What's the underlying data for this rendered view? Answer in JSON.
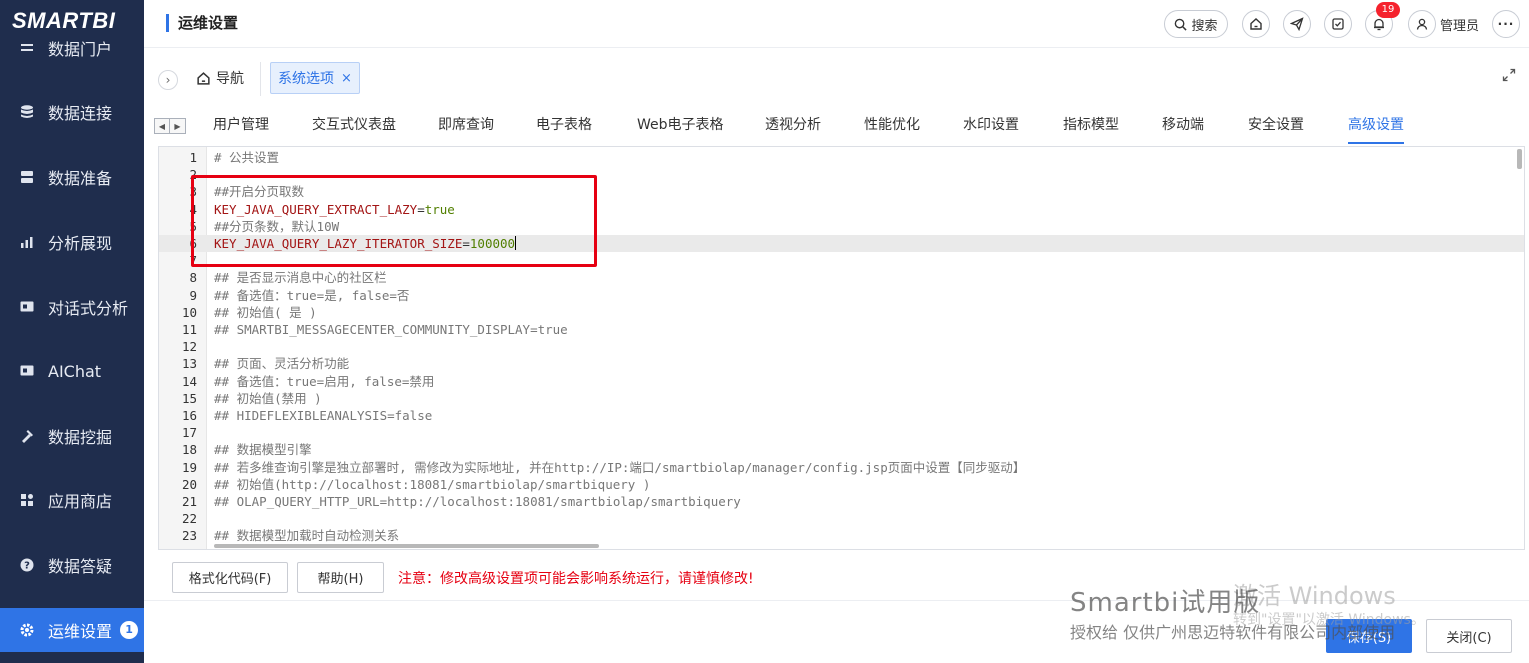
{
  "logo": "SMARTBI",
  "sidebar": {
    "items": [
      {
        "label": "数据门户",
        "icon": "portal-icon"
      },
      {
        "label": "数据连接",
        "icon": "database-icon"
      },
      {
        "label": "数据准备",
        "icon": "data-prep-icon"
      },
      {
        "label": "分析展现",
        "icon": "bar-chart-icon"
      },
      {
        "label": "对话式分析",
        "icon": "dialog-analysis-icon"
      },
      {
        "label": "AIChat",
        "icon": "ai-chat-icon"
      },
      {
        "label": "数据挖掘",
        "icon": "mining-icon"
      },
      {
        "label": "应用商店",
        "icon": "app-store-icon"
      },
      {
        "label": "数据答疑",
        "icon": "question-icon"
      },
      {
        "label": "运维设置",
        "icon": "gear-icon",
        "badge": "1",
        "active": true
      }
    ]
  },
  "header": {
    "title": "运维设置",
    "search_label": "搜索",
    "notification_count": "19",
    "user_name": "管理员"
  },
  "navbar": {
    "home_label": "导航",
    "open_tab": "系统选项",
    "close_symbol": "×"
  },
  "tabs": [
    {
      "label": "用户管理"
    },
    {
      "label": "交互式仪表盘"
    },
    {
      "label": "即席查询"
    },
    {
      "label": "电子表格"
    },
    {
      "label": "Web电子表格"
    },
    {
      "label": "透视分析"
    },
    {
      "label": "性能优化"
    },
    {
      "label": "水印设置"
    },
    {
      "label": "指标模型"
    },
    {
      "label": "移动端"
    },
    {
      "label": "安全设置"
    },
    {
      "label": "高级设置",
      "active": true
    }
  ],
  "editor": {
    "lines": [
      {
        "num": "1",
        "text": "# 公共设置"
      },
      {
        "num": "2",
        "text": ""
      },
      {
        "num": "3",
        "text": "##开启分页取数"
      },
      {
        "num": "4",
        "key": "KEY_JAVA_QUERY_EXTRACT_LAZY",
        "value": "true"
      },
      {
        "num": "5",
        "text": "##分页条数，默认10W"
      },
      {
        "num": "6",
        "key": "KEY_JAVA_QUERY_LAZY_ITERATOR_SIZE",
        "value": "100000"
      },
      {
        "num": "7",
        "text": ""
      },
      {
        "num": "8",
        "text": "## 是否显示消息中心的社区栏"
      },
      {
        "num": "9",
        "text": "## 备选值：true=是, false=否"
      },
      {
        "num": "10",
        "text": "## 初始值( 是 )"
      },
      {
        "num": "11",
        "text": "## SMARTBI_MESSAGECENTER_COMMUNITY_DISPLAY=true"
      },
      {
        "num": "12",
        "text": ""
      },
      {
        "num": "13",
        "text": "## 页面、灵活分析功能"
      },
      {
        "num": "14",
        "text": "## 备选值：true=启用, false=禁用"
      },
      {
        "num": "15",
        "text": "## 初始值(禁用 )"
      },
      {
        "num": "16",
        "text": "## HIDEFLEXIBLEANALYSIS=false"
      },
      {
        "num": "17",
        "text": ""
      },
      {
        "num": "18",
        "text": "## 数据模型引擎"
      },
      {
        "num": "19",
        "text": "## 若多维查询引擎是独立部署时, 需修改为实际地址, 并在http://IP:端口/smartbiolap/manager/config.jsp页面中设置【同步驱动】"
      },
      {
        "num": "20",
        "text": "## 初始值(http://localhost:18081/smartbiolap/smartbiquery )"
      },
      {
        "num": "21",
        "text": "## OLAP_QUERY_HTTP_URL=http://localhost:18081/smartbiolap/smartbiquery"
      },
      {
        "num": "22",
        "text": ""
      },
      {
        "num": "23",
        "text": "## 数据模型加载时自动检测关系"
      }
    ],
    "eq": "="
  },
  "footer": {
    "format_btn": "格式化代码(F)",
    "help_btn": "帮助(H)",
    "warning": "注意：修改高级设置项可能会影响系统运行，请谨慎修改!",
    "save_btn": "保存(S)",
    "close_btn": "关闭(C)"
  },
  "watermark": {
    "trial": "Smartbi试用版",
    "license": "授权给 仅供广州思迈特软件有限公司内部使用",
    "windows_title": "激活 Windows",
    "windows_sub": "转到\"设置\"以激活 Windows。"
  }
}
